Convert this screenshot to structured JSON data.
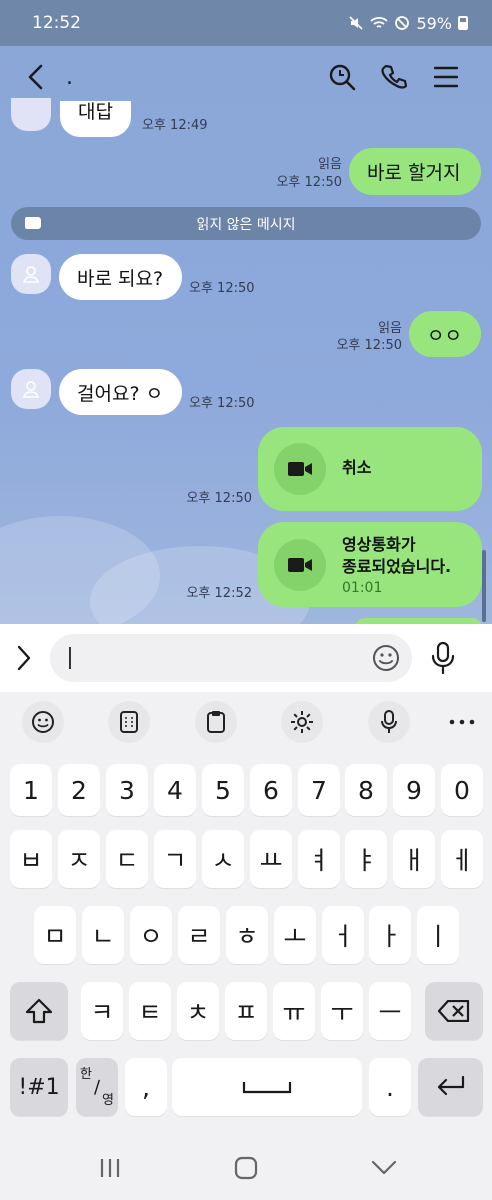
{
  "status_bar": {
    "time": "12:52",
    "battery": "59%"
  },
  "header": {
    "title": "."
  },
  "messages": {
    "m1": {
      "text": "대답",
      "time": "오후 12:49"
    },
    "m2": {
      "text": "바로 할거지",
      "read": "읽음",
      "time": "오후 12:50"
    },
    "unread_divider": "읽지 않은 메시지",
    "m3": {
      "text": "바로 되요?",
      "time": "오후 12:50"
    },
    "m4": {
      "text": "ㅇㅇ",
      "read": "읽음",
      "time": "오후 12:50"
    },
    "m5": {
      "text": "걸어요? ㅇ",
      "time": "오후 12:50"
    },
    "call1": {
      "text": "취소",
      "time": "오후 12:50"
    },
    "call2": {
      "line1": "영상통화가",
      "line2": "종료되었습니다.",
      "duration": "01:01",
      "time": "오후 12:52"
    }
  },
  "input": {
    "value": "",
    "placeholder": ""
  },
  "keyboard": {
    "numbers": [
      "1",
      "2",
      "3",
      "4",
      "5",
      "6",
      "7",
      "8",
      "9",
      "0"
    ],
    "row1": [
      "ㅂ",
      "ㅈ",
      "ㄷ",
      "ㄱ",
      "ㅅ",
      "ㅛ",
      "ㅕ",
      "ㅑ",
      "ㅐ",
      "ㅔ"
    ],
    "row2": [
      "ㅁ",
      "ㄴ",
      "ㅇ",
      "ㄹ",
      "ㅎ",
      "ㅗ",
      "ㅓ",
      "ㅏ",
      "ㅣ"
    ],
    "row3": [
      "ㅋ",
      "ㅌ",
      "ㅊ",
      "ㅍ",
      "ㅠ",
      "ㅜ",
      "ㅡ"
    ],
    "symbols": "!#1",
    "lang_top": "한",
    "lang_bottom": "영",
    "comma": ",",
    "period": "."
  },
  "icons": {
    "back": "chevron-left-icon",
    "search": "search-chat-icon",
    "call": "phone-icon",
    "menu": "hamburger-icon",
    "video": "video-camera-icon",
    "emoji": "smiley-icon",
    "mic": "microphone-icon"
  },
  "colors": {
    "chat_background": "#8aa7d8",
    "my_bubble": "#98e57e",
    "other_bubble": "#ffffff",
    "unread_bar": "#6d84a9"
  }
}
